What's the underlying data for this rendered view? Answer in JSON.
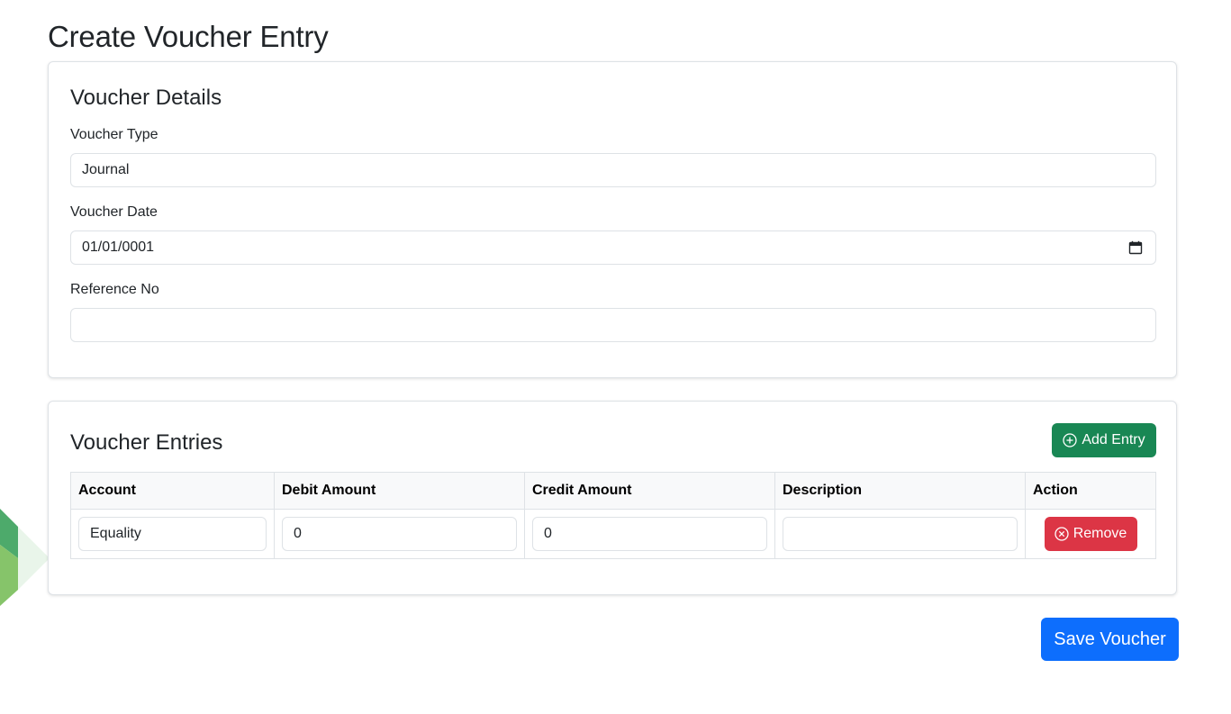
{
  "page": {
    "title": "Create Voucher Entry"
  },
  "details": {
    "title": "Voucher Details",
    "voucher_type_label": "Voucher Type",
    "voucher_type_value": "Journal",
    "voucher_date_label": "Voucher Date",
    "voucher_date_value": "01/01/0001",
    "reference_no_label": "Reference No",
    "reference_no_value": ""
  },
  "entries": {
    "title": "Voucher Entries",
    "add_label": "Add Entry",
    "columns": [
      "Account",
      "Debit Amount",
      "Credit Amount",
      "Description",
      "Action"
    ],
    "rows": [
      {
        "account": "Equality",
        "debit": "0",
        "credit": "0",
        "description": "",
        "remove_label": "Remove"
      }
    ]
  },
  "save_label": "Save Voucher",
  "colors": {
    "add_button": "#198754",
    "remove_button": "#dc3545",
    "save_button": "#0d6efd",
    "decor_green_dark": "#4caf50",
    "decor_green_light": "#8bc34a"
  },
  "icons": {
    "add": "plus-circle-icon",
    "remove": "x-circle-icon",
    "date": "calendar-icon"
  }
}
